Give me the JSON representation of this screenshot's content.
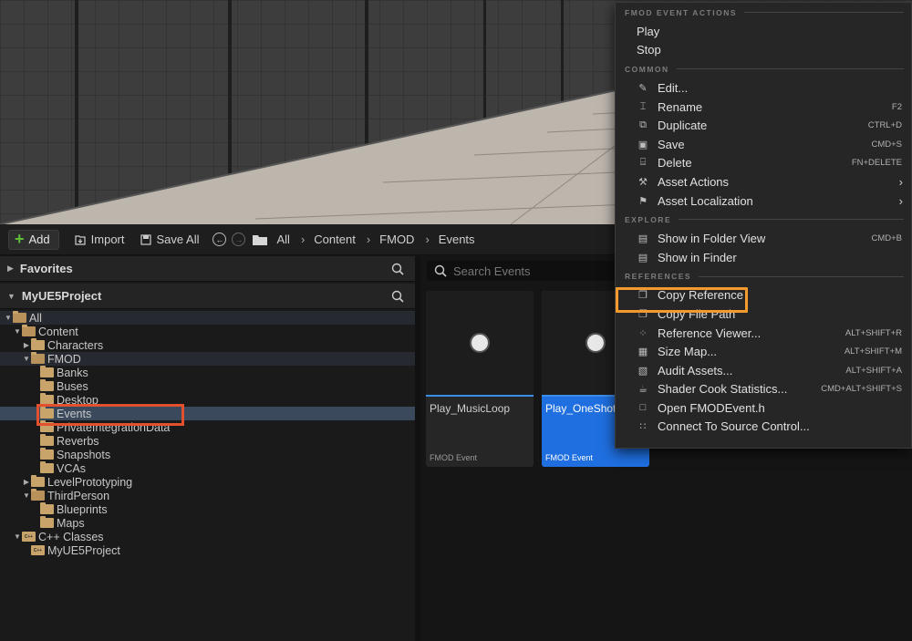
{
  "toolbar": {
    "add_label": "Add",
    "import_label": "Import",
    "save_all_label": "Save All",
    "breadcrumb": [
      "All",
      "Content",
      "FMOD",
      "Events"
    ]
  },
  "left_panel": {
    "favorites_label": "Favorites",
    "project_label": "MyUE5Project",
    "tree": [
      {
        "label": "All",
        "depth": 0,
        "arrow": "down",
        "icon": "folder-open"
      },
      {
        "label": "Content",
        "depth": 1,
        "arrow": "down",
        "icon": "folder-open"
      },
      {
        "label": "Characters",
        "depth": 2,
        "arrow": "right",
        "icon": "folder"
      },
      {
        "label": "FMOD",
        "depth": 2,
        "arrow": "down",
        "icon": "folder-open"
      },
      {
        "label": "Banks",
        "depth": 3,
        "arrow": "",
        "icon": "folder"
      },
      {
        "label": "Buses",
        "depth": 3,
        "arrow": "",
        "icon": "folder"
      },
      {
        "label": "Desktop",
        "depth": 3,
        "arrow": "",
        "icon": "folder"
      },
      {
        "label": "Events",
        "depth": 3,
        "arrow": "",
        "icon": "folder",
        "selected": true
      },
      {
        "label": "PrivateIntegrationData",
        "depth": 3,
        "arrow": "",
        "icon": "folder"
      },
      {
        "label": "Reverbs",
        "depth": 3,
        "arrow": "",
        "icon": "folder"
      },
      {
        "label": "Snapshots",
        "depth": 3,
        "arrow": "",
        "icon": "folder"
      },
      {
        "label": "VCAs",
        "depth": 3,
        "arrow": "",
        "icon": "folder"
      },
      {
        "label": "LevelPrototyping",
        "depth": 2,
        "arrow": "right",
        "icon": "folder"
      },
      {
        "label": "ThirdPerson",
        "depth": 2,
        "arrow": "down",
        "icon": "folder-open"
      },
      {
        "label": "Blueprints",
        "depth": 3,
        "arrow": "",
        "icon": "folder"
      },
      {
        "label": "Maps",
        "depth": 3,
        "arrow": "",
        "icon": "folder"
      },
      {
        "label": "C++ Classes",
        "depth": 1,
        "arrow": "down",
        "icon": "cpp-folder"
      },
      {
        "label": "MyUE5Project",
        "depth": 2,
        "arrow": "",
        "icon": "cpp-folder"
      }
    ]
  },
  "assets": {
    "search_placeholder": "Search Events",
    "tiles": [
      {
        "name": "Play_MusicLoop",
        "type": "FMOD Event",
        "selected": false
      },
      {
        "name": "Play_OneShot",
        "type": "FMOD Event",
        "selected": true
      }
    ]
  },
  "context_menu": {
    "sections": [
      {
        "header": "FMOD EVENT ACTIONS",
        "items": [
          {
            "label": "Play",
            "icon": "",
            "shortcut": ""
          },
          {
            "label": "Stop",
            "icon": "",
            "shortcut": ""
          }
        ]
      },
      {
        "header": "COMMON",
        "items": [
          {
            "label": "Edit...",
            "icon": "pencil-icon",
            "shortcut": ""
          },
          {
            "label": "Rename",
            "icon": "rename-icon",
            "shortcut": "F2"
          },
          {
            "label": "Duplicate",
            "icon": "duplicate-icon",
            "shortcut": "CTRL+D"
          },
          {
            "label": "Save",
            "icon": "save-icon",
            "shortcut": "CMD+S"
          },
          {
            "label": "Delete",
            "icon": "trash-icon",
            "shortcut": "FN+DELETE"
          },
          {
            "label": "Asset Actions",
            "icon": "wrench-icon",
            "shortcut": "",
            "submenu": true
          },
          {
            "label": "Asset Localization",
            "icon": "flag-icon",
            "shortcut": "",
            "submenu": true
          }
        ]
      },
      {
        "header": "EXPLORE",
        "items": [
          {
            "label": "Show in Folder View",
            "icon": "folder-search-icon",
            "shortcut": "CMD+B"
          },
          {
            "label": "Show in Finder",
            "icon": "finder-icon",
            "shortcut": ""
          }
        ]
      },
      {
        "header": "REFERENCES",
        "items": [
          {
            "label": "Copy Reference",
            "icon": "copy-icon",
            "shortcut": "",
            "highlighted": true
          },
          {
            "label": "Copy File Path",
            "icon": "copy-path-icon",
            "shortcut": ""
          },
          {
            "label": "Reference Viewer...",
            "icon": "reference-viewer-icon",
            "shortcut": "ALT+SHIFT+R"
          },
          {
            "label": "Size Map...",
            "icon": "size-map-icon",
            "shortcut": "ALT+SHIFT+M"
          },
          {
            "label": "Audit Assets...",
            "icon": "audit-icon",
            "shortcut": "ALT+SHIFT+A"
          },
          {
            "label": "Shader Cook Statistics...",
            "icon": "shader-icon",
            "shortcut": "CMD+ALT+SHIFT+S"
          },
          {
            "label": "Open FMODEvent.h",
            "icon": "cpp-file-icon",
            "shortcut": ""
          },
          {
            "label": "Connect To Source Control...",
            "icon": "source-control-icon",
            "shortcut": ""
          }
        ]
      }
    ]
  },
  "colors": {
    "selection_blue": "#1f6fe0",
    "events_highlight_border": "#e2502e",
    "copy_reference_highlight_border": "#f29a2e",
    "folder": "#c9a46a",
    "add_plus": "#5fbf3a"
  }
}
